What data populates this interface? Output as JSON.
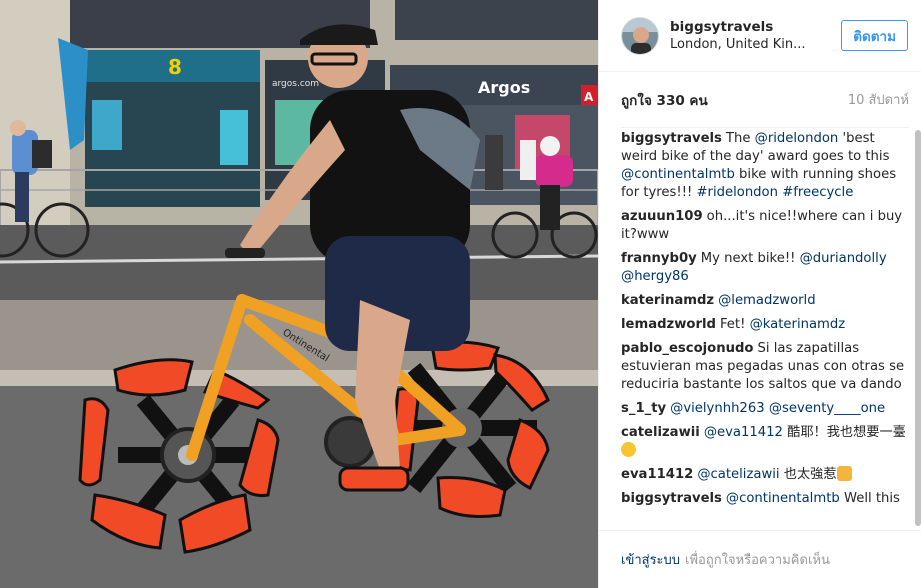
{
  "post": {
    "username": "biggsytravels",
    "location": "London, United Kin...",
    "follow_label": "ติดตาม",
    "likes": "ถูกใจ 330 คน",
    "time_ago": "10 สัปดาห์"
  },
  "photo": {
    "signs": {
      "ee": "8",
      "argos": "Argos",
      "argos_small": "argos.com",
      "red_box": "A",
      "bike_brand": "Ontinental"
    }
  },
  "comments": [
    {
      "user": "biggsytravels",
      "parts": [
        {
          "t": "The "
        },
        {
          "t": "@ridelondon",
          "m": true
        },
        {
          "t": " 'best weird bike of the day' award goes to this "
        },
        {
          "t": "@continentalmtb",
          "m": true
        },
        {
          "t": " bike with running shoes for tyres!!! "
        },
        {
          "t": "#ridelondon",
          "m": true
        },
        {
          "t": " "
        },
        {
          "t": "#freecycle",
          "m": true
        }
      ]
    },
    {
      "user": "azuuun109",
      "parts": [
        {
          "t": "oh...it's nice!!where can i buy it?www"
        }
      ]
    },
    {
      "user": "frannyb0y",
      "parts": [
        {
          "t": "My next bike!! "
        },
        {
          "t": "@duriandolly",
          "m": true
        },
        {
          "t": " "
        },
        {
          "t": "@hergy86",
          "m": true
        }
      ]
    },
    {
      "user": "katerinamdz",
      "parts": [
        {
          "t": "@lemadzworld",
          "m": true
        }
      ]
    },
    {
      "user": "lemadzworld",
      "parts": [
        {
          "t": "Fet! "
        },
        {
          "t": "@katerinamdz",
          "m": true
        }
      ]
    },
    {
      "user": "pablo_escojonudo",
      "parts": [
        {
          "t": "Si las zapatillas estuvieran mas pegadas unas con otras se reduciria bastante los saltos que va dando"
        }
      ]
    },
    {
      "user": "s_1_ty",
      "parts": [
        {
          "t": "@vielynhh263",
          "m": true
        },
        {
          "t": " "
        },
        {
          "t": "@seventy____one",
          "m": true
        }
      ]
    },
    {
      "user": "catelizawii",
      "parts": [
        {
          "t": "@eva11412",
          "m": true
        },
        {
          "t": " 酷耶！我也想要一臺"
        },
        {
          "e": "grin"
        }
      ]
    },
    {
      "user": "eva11412",
      "parts": [
        {
          "t": "@catelizawii",
          "m": true
        },
        {
          "t": " 也太強惹"
        },
        {
          "e": "thumb"
        }
      ]
    },
    {
      "user": "biggsytravels",
      "parts": [
        {
          "t": "@continentalmtb",
          "m": true
        },
        {
          "t": " Well this"
        }
      ]
    }
  ],
  "footer": {
    "login": "เข้าสู่ระบบ",
    "hint": "เพื่อถูกใจหรือความคิดเห็น"
  },
  "colors": {
    "accent": "#3897f0",
    "link": "#003569",
    "muted": "#999999",
    "bike_orange": "#f0a022",
    "shoe_red": "#f04a26"
  }
}
